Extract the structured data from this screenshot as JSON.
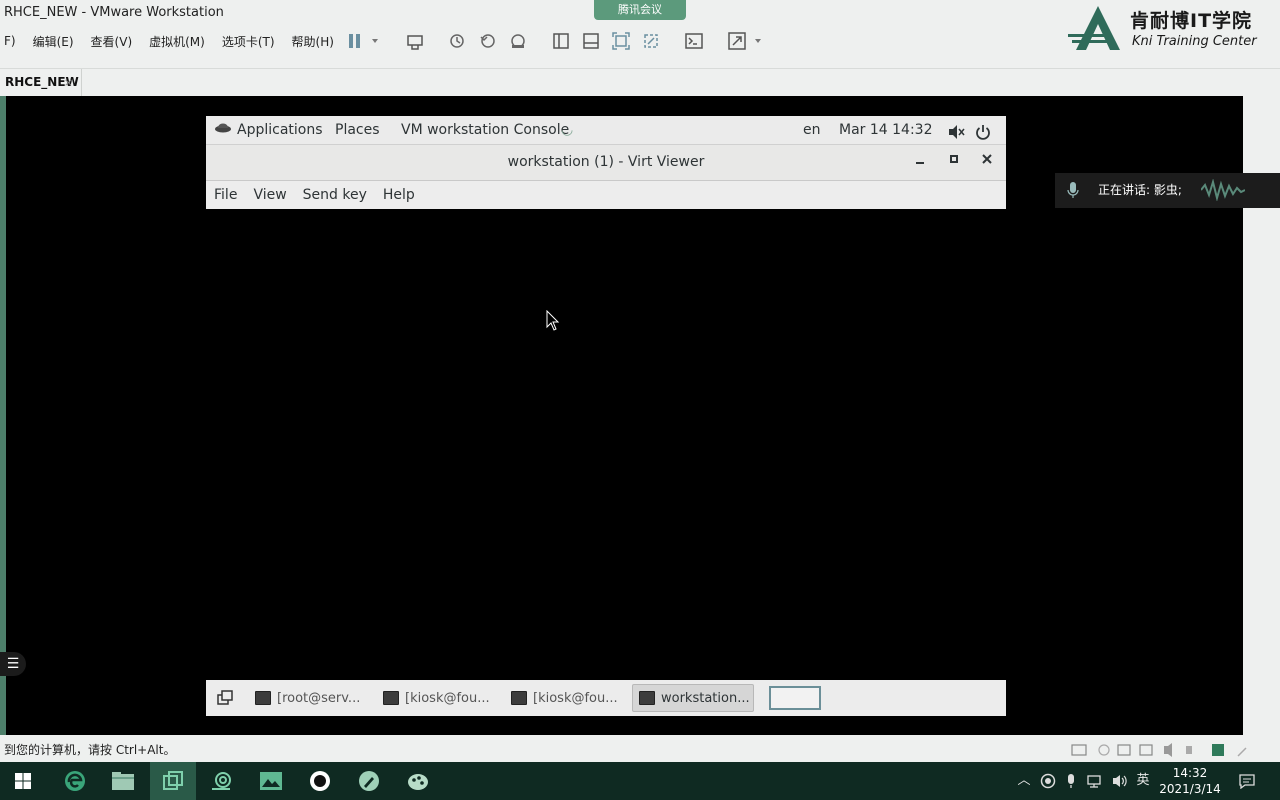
{
  "vmware": {
    "title": "RHCE_NEW - VMware Workstation",
    "menu": [
      "F)",
      "编辑(E)",
      "查看(V)",
      "虚拟机(M)",
      "选项卡(T)",
      "帮助(H)"
    ],
    "tab_label": "RHCE_NEW",
    "status_text": "到您的计算机，请按 Ctrl+Alt。"
  },
  "meeting": {
    "pill_label": "腾讯会议",
    "speaking_text": "正在讲话: 影虫;"
  },
  "logo": {
    "name_cn": "肯耐博IT学院",
    "name_en": "Kni Training Center"
  },
  "gnome": {
    "applications": "Applications",
    "places": "Places",
    "active_app": "VM workstation Console",
    "lang": "en",
    "datetime": "Mar 14  14:32"
  },
  "viewer": {
    "title": "workstation (1) - Virt Viewer",
    "menu": [
      "File",
      "View",
      "Send key",
      "Help"
    ]
  },
  "window_list": [
    "[root@serv...",
    "[kiosk@fou...",
    "[kiosk@fou...",
    "workstation..."
  ],
  "taskbar": {
    "ime": "英",
    "time": "14:32",
    "date": "2021/3/14"
  },
  "colors": {
    "vm_background": "#000000",
    "taskbar": "#0f2a22",
    "meeting_accent": "#5c9a7c"
  }
}
